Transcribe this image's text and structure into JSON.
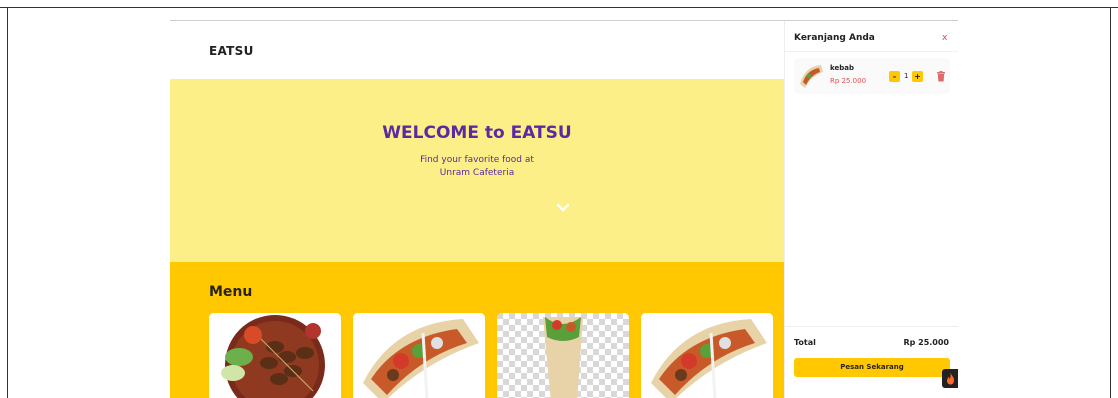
{
  "brand": {
    "logo": "EATSU"
  },
  "hero": {
    "title": "WELCOME to EATSU",
    "subtitle_line1": "Find your favorite food at",
    "subtitle_line2": "Unram Cafeteria",
    "chevron_icon": "chevron-down-icon"
  },
  "menu": {
    "title": "Menu",
    "cards": [
      {
        "image": "satay-plate-image"
      },
      {
        "image": "kebab-wrap-image"
      },
      {
        "image": "kebab-wrap-transparent-image"
      },
      {
        "image": "kebab-wrap-image"
      }
    ]
  },
  "cart": {
    "title": "Keranjang Anda",
    "close_label": "x",
    "items": [
      {
        "name": "kebab",
        "price": "Rp 25.000",
        "minus": "-",
        "qty": "1",
        "plus": "+",
        "delete_icon": "trash-icon"
      }
    ],
    "total_label": "Total",
    "total_value": "Rp 25.000",
    "order_button": "Pesan Sekarang"
  },
  "colors": {
    "hero_bg": "#fdef88",
    "menu_bg": "#ffc800",
    "accent_purple": "#5a2aa0",
    "price_red": "#e05050"
  }
}
